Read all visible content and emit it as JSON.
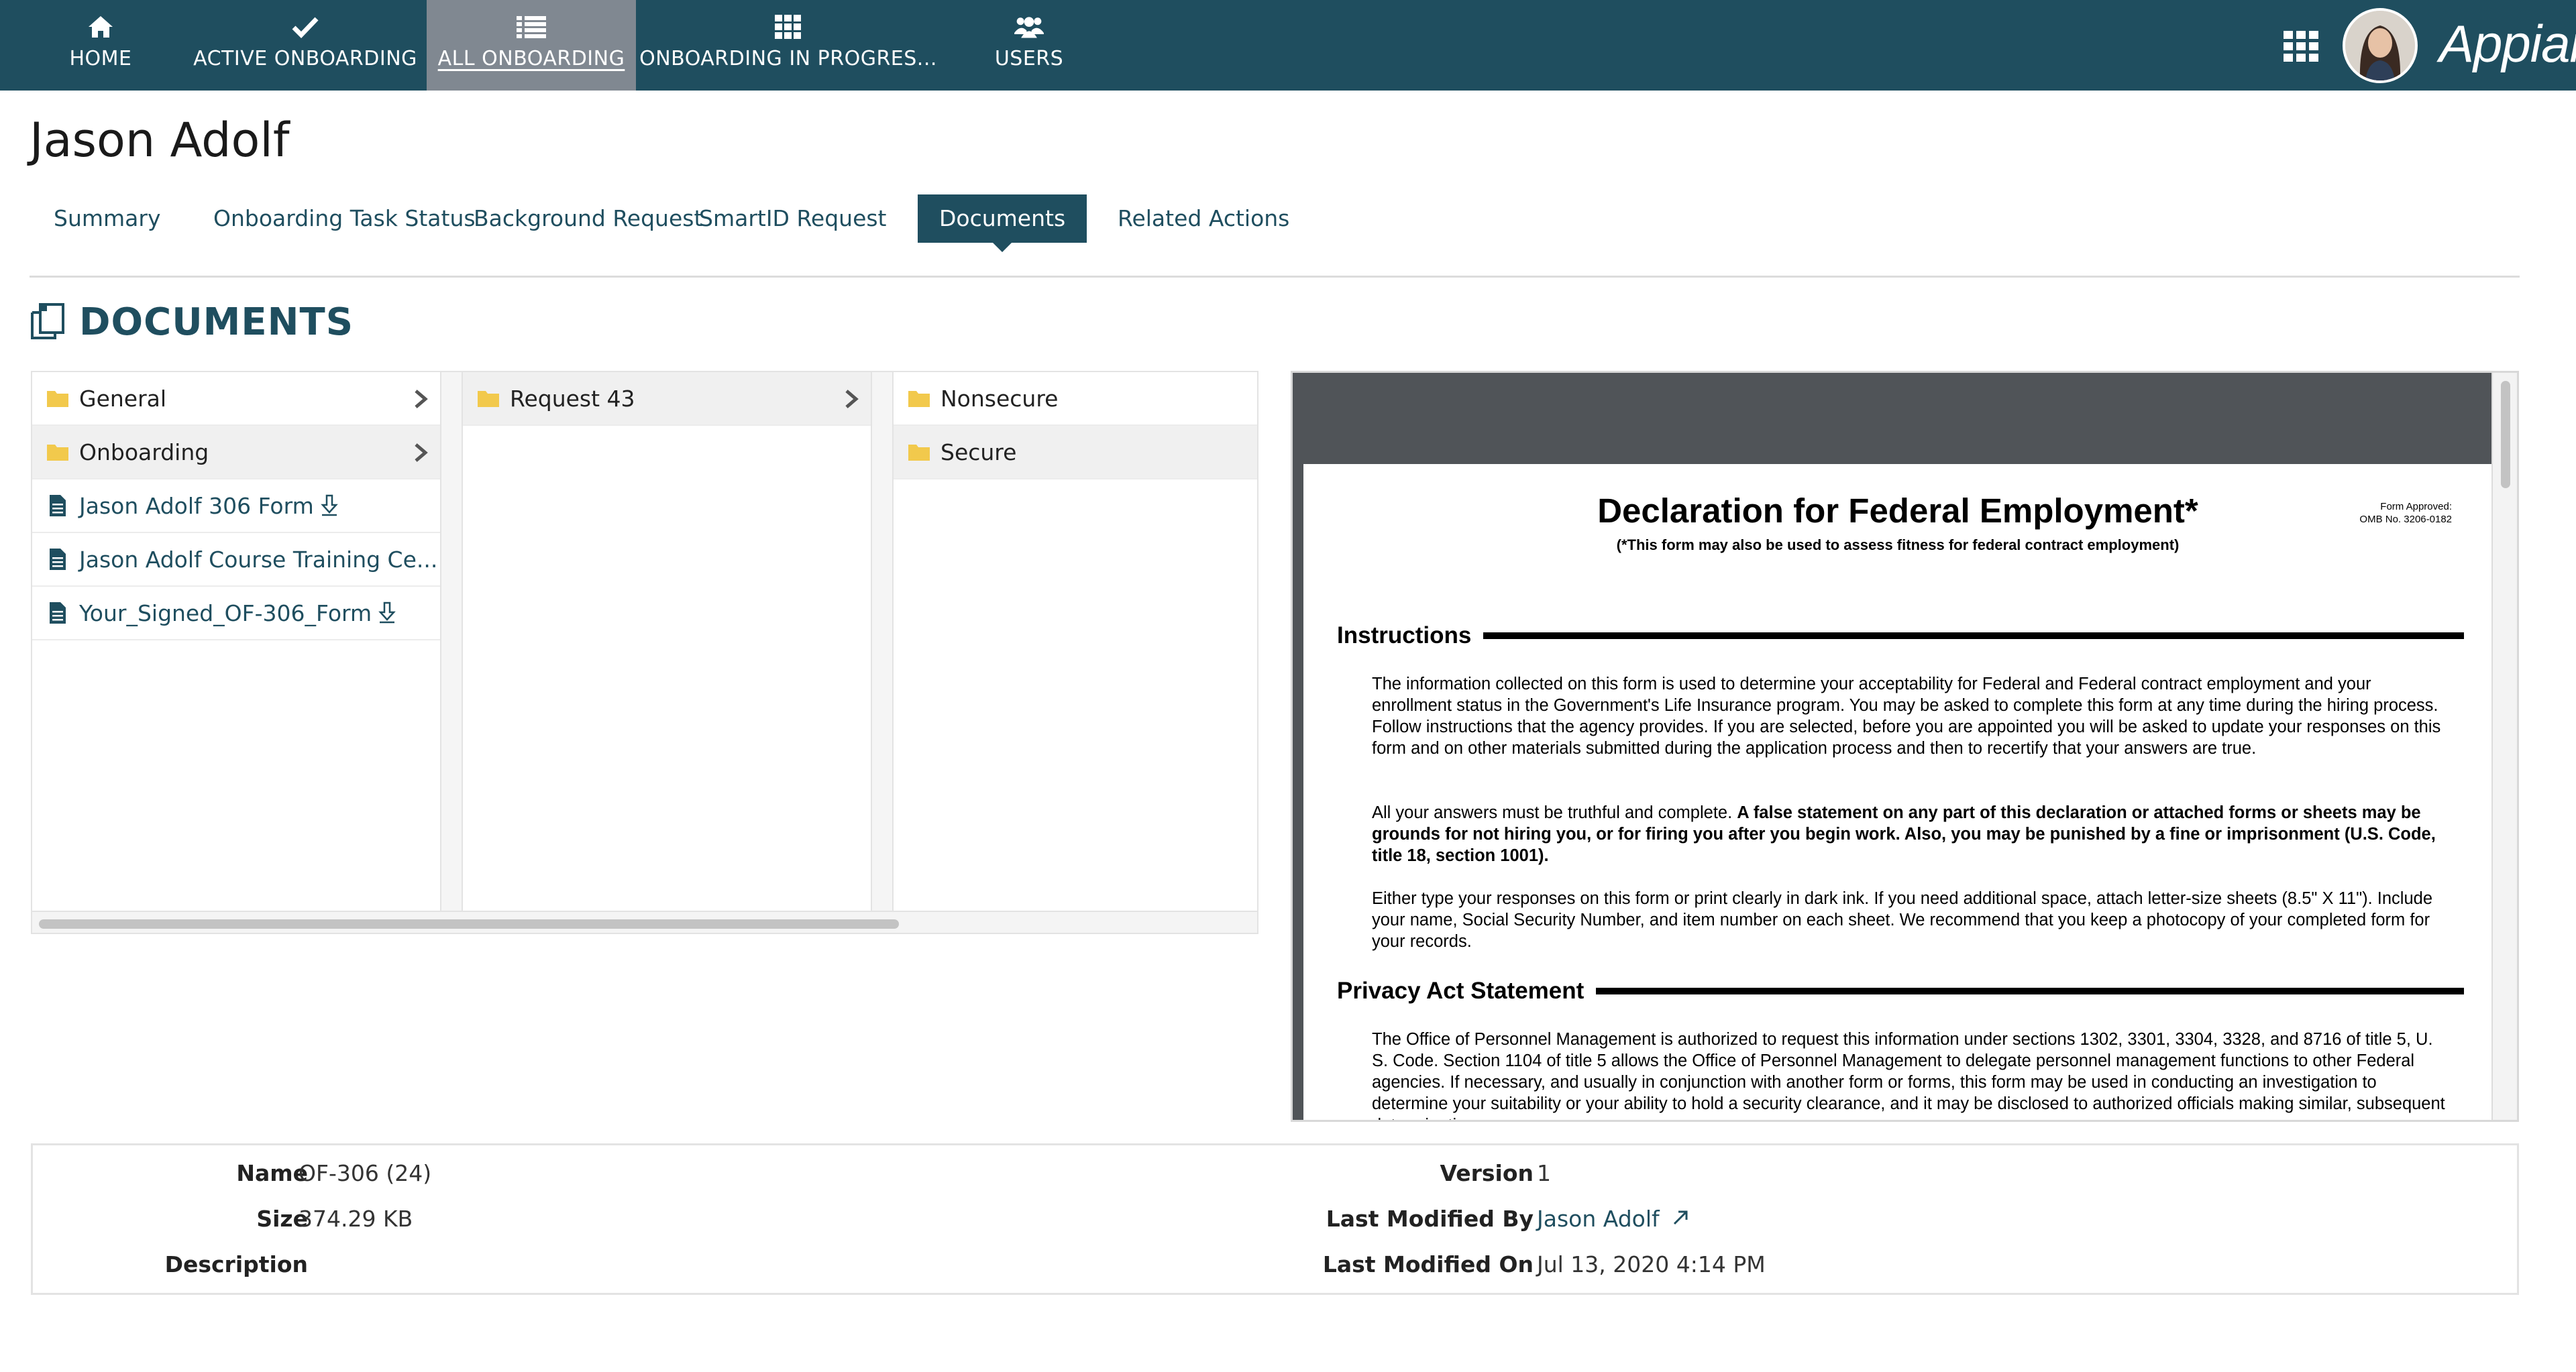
{
  "nav": {
    "items": [
      {
        "label": "HOME",
        "icon": "home-icon"
      },
      {
        "label": "ACTIVE ONBOARDING",
        "icon": "check-icon"
      },
      {
        "label": "ALL ONBOARDING",
        "icon": "list-icon",
        "active": true
      },
      {
        "label": "ONBOARDING IN PROGRES...",
        "icon": "grid-icon"
      },
      {
        "label": "USERS",
        "icon": "users-icon"
      }
    ],
    "brand": "Appian"
  },
  "page": {
    "title": "Jason Adolf"
  },
  "tabs": [
    {
      "label": "Summary"
    },
    {
      "label": "Onboarding Task Status"
    },
    {
      "label": "Background Request"
    },
    {
      "label": "SmartID Request"
    },
    {
      "label": "Documents",
      "active": true
    },
    {
      "label": "Related Actions"
    }
  ],
  "documents": {
    "section_title": "DOCUMENTS",
    "columns": [
      {
        "items": [
          {
            "label": "General",
            "type": "folder"
          },
          {
            "label": "Onboarding",
            "type": "folder",
            "selected": true
          },
          {
            "label": "Jason Adolf 306 Form",
            "type": "file",
            "download": true
          },
          {
            "label": "Jason Adolf Course Training Ce...",
            "type": "file"
          },
          {
            "label": "Your_Signed_OF-306_Form",
            "type": "file",
            "download": true
          }
        ]
      },
      {
        "items": [
          {
            "label": "Request 43",
            "type": "folder",
            "selected": true
          }
        ]
      },
      {
        "items": [
          {
            "label": "Nonsecure",
            "type": "folder"
          },
          {
            "label": "Secure",
            "type": "folder",
            "selected": true
          }
        ]
      }
    ]
  },
  "preview": {
    "title": "Declaration for Federal Employment*",
    "subtitle": "(*This form may also be used to assess fitness for federal contract employment)",
    "approval_line1": "Form Approved:",
    "approval_line2": "OMB No.  3206-0182",
    "instructions_heading": "Instructions",
    "para1": "The information collected on this form is used to determine your acceptability for Federal and Federal contract employment and your enrollment status in the Government's Life Insurance program.  You may be asked to complete this form at any time during the hiring process.  Follow instructions that the agency provides.  If you are selected, before you are appointed you will be asked to update your responses on this form and on other materials submitted during the application process and then to recertify that your answers are true.",
    "para2_a": "All your answers must be truthful and complete.  ",
    "para2_b": "A false statement on any part of this declaration or attached forms or sheets may be grounds for not hiring you, or for firing you after you begin work.  Also, you may be punished by a fine or imprisonment (U.S. Code, title 18, section 1001).",
    "para3": "Either type your responses on this form or print clearly in dark ink. If you need additional space, attach letter-size sheets (8.5\" X 11\"). Include your name, Social Security Number, and item number on each sheet. We recommend that you keep a photocopy of your completed form for your records.",
    "privacy_heading": "Privacy Act Statement",
    "para4": "The Office of Personnel Management is authorized to request this information under sections 1302, 3301, 3304, 3328, and 8716 of title 5, U. S. Code.  Section 1104 of title 5 allows the Office of Personnel Management to delegate personnel management functions to other Federal agencies.  If necessary, and usually in conjunction with another form or forms, this form may be used in conducting an investigation to determine your suitability or your ability to hold a security clearance, and it may be disclosed to authorized officials making similar, subsequent determinations."
  },
  "properties": {
    "name_label": "Name",
    "name_value": "OF-306 (24)",
    "size_label": "Size",
    "size_value": "374.29 KB",
    "description_label": "Description",
    "version_label": "Version",
    "version_value": "1",
    "modified_by_label": "Last Modified By",
    "modified_by_value": "Jason Adolf",
    "modified_on_label": "Last Modified On",
    "modified_on_value": "Jul 13, 2020 4:14 PM"
  },
  "colors": {
    "header_bg": "#1f4e5f",
    "active_nav_bg": "#808891",
    "folder": "#f2c94c",
    "link": "#1f4e5f"
  }
}
